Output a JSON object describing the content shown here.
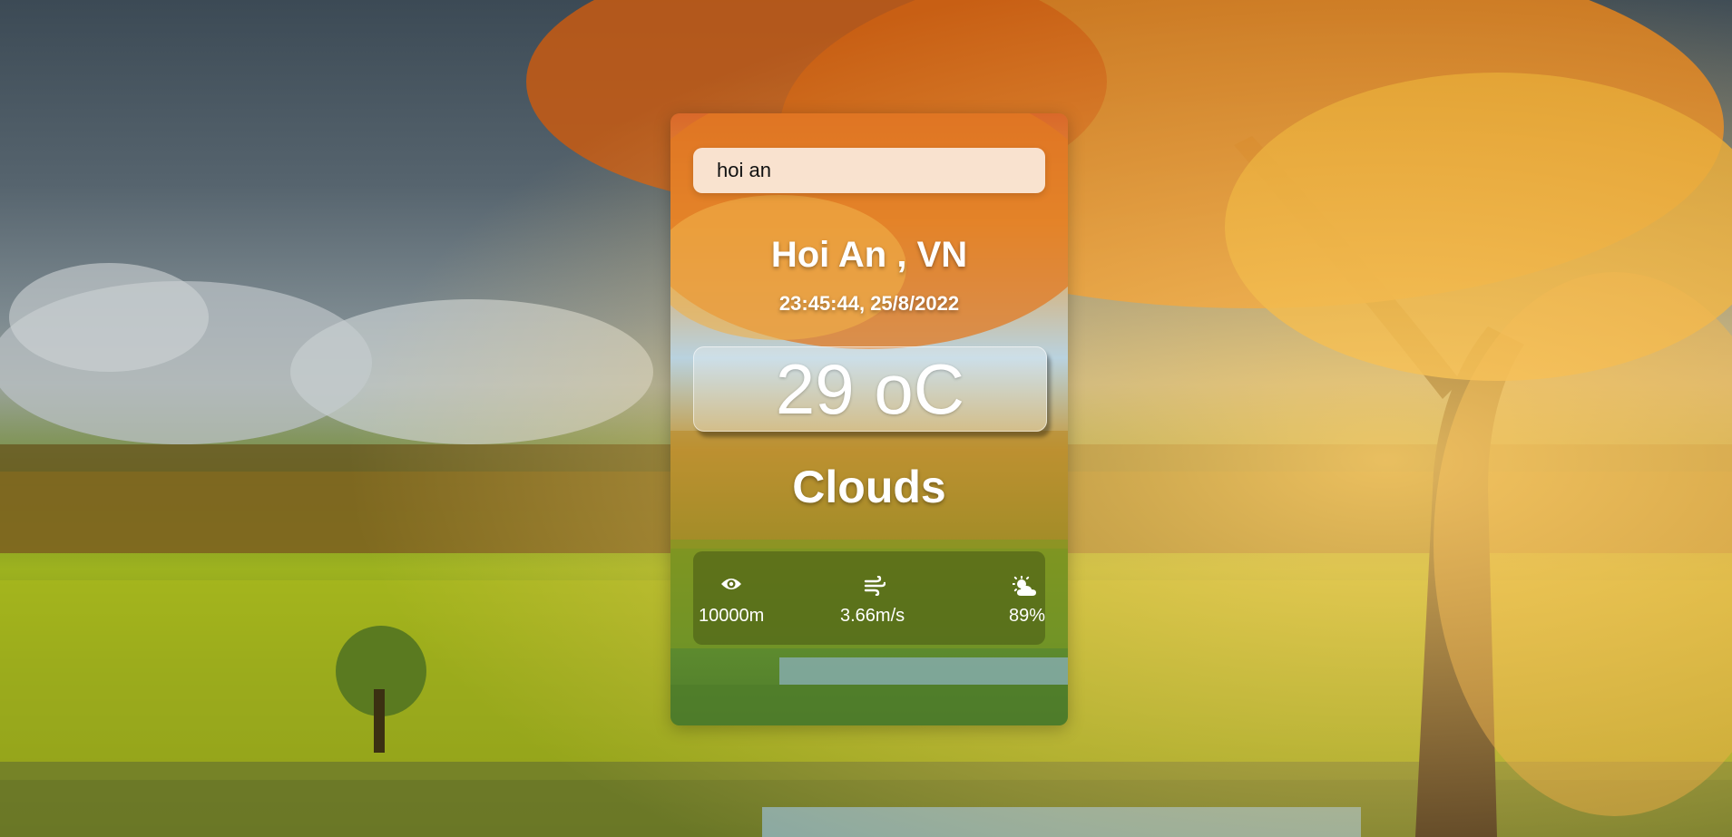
{
  "search": {
    "value": "hoi an"
  },
  "location": {
    "name": "Hoi An , VN"
  },
  "datetime": "23:45:44, 25/8/2022",
  "temperature": "29 oC",
  "condition": "Clouds",
  "stats": {
    "visibility": {
      "icon": "eye-icon",
      "value": "10000m"
    },
    "wind": {
      "icon": "wind-icon",
      "value": "3.66m/s"
    },
    "humidity": {
      "icon": "cloud-sun-icon",
      "value": "89%"
    }
  }
}
